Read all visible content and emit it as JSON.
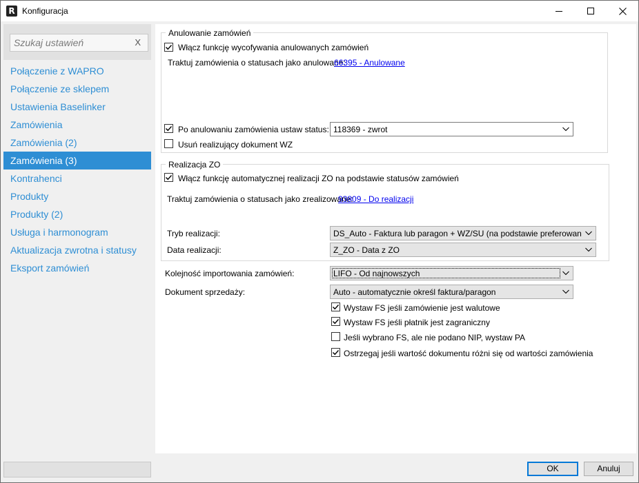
{
  "window": {
    "app_icon_letter": "R",
    "title": "Konfiguracja"
  },
  "sidebar": {
    "search_placeholder": "Szukaj ustawień",
    "search_clear": "X",
    "items": [
      {
        "label": "Połączenie z WAPRO",
        "active": false
      },
      {
        "label": "Połączenie ze sklepem",
        "active": false
      },
      {
        "label": "Ustawienia Baselinker",
        "active": false
      },
      {
        "label": "Zamówienia",
        "active": false
      },
      {
        "label": "Zamówienia (2)",
        "active": false
      },
      {
        "label": "Zamówienia (3)",
        "active": true
      },
      {
        "label": "Kontrahenci",
        "active": false
      },
      {
        "label": "Produkty",
        "active": false
      },
      {
        "label": "Produkty (2)",
        "active": false
      },
      {
        "label": "Usługa i harmonogram",
        "active": false
      },
      {
        "label": "Aktualizacja zwrotna i statusy",
        "active": false
      },
      {
        "label": "Eksport zamówień",
        "active": false
      }
    ]
  },
  "cancel_group": {
    "title": "Anulowanie zamówień",
    "enable_checkbox": {
      "label": "Włącz funkcję wycofywania anulowanych zamówień",
      "checked": true
    },
    "treat_label": "Traktuj zamówienia o statusach jako anulowane:",
    "treat_link": "66395 - Anulowane",
    "after_cancel_checkbox": {
      "label": "Po anulowaniu zamówienia ustaw status:",
      "checked": true
    },
    "after_cancel_value": "118369 - zwrot",
    "remove_wz_checkbox": {
      "label": "Usuń realizujący dokument WZ",
      "checked": false
    }
  },
  "zo_group": {
    "title": "Realizacja ZO",
    "enable_checkbox": {
      "label": "Włącz funkcję automatycznej realizacji ZO na podstawie statusów zamówień",
      "checked": true
    },
    "treat_label": "Traktuj zamówienia o statusach jako zrealizowane:",
    "treat_link": "93809 - Do realizacji",
    "mode_label": "Tryb realizacji:",
    "mode_value": "DS_Auto - Faktura lub paragon + WZ/SU (na podstawie preferowanego dok",
    "date_label": "Data realizacji:",
    "date_value": "Z_ZO - Data z ZO"
  },
  "import_order": {
    "label": "Kolejność importowania zamówień:",
    "value": "LIFO - Od najnowszych"
  },
  "sale_document": {
    "label": "Dokument sprzedaży:",
    "value": "Auto - automatycznie określ faktura/paragon"
  },
  "options": [
    {
      "label": "Wystaw FS jeśli zamówienie jest walutowe",
      "checked": true
    },
    {
      "label": "Wystaw FS jeśli płatnik jest zagraniczny",
      "checked": true
    },
    {
      "label": "Jeśli wybrano FS, ale nie podano NIP, wystaw PA",
      "checked": false
    },
    {
      "label": "Ostrzegaj jeśli wartość dokumentu różni się od wartości zamówienia",
      "checked": true
    }
  ],
  "buttons": {
    "ok": "OK",
    "cancel": "Anuluj"
  },
  "colors": {
    "accent": "#2e8ed4",
    "link": "#0000ee",
    "default_button_border": "#0078d7"
  }
}
